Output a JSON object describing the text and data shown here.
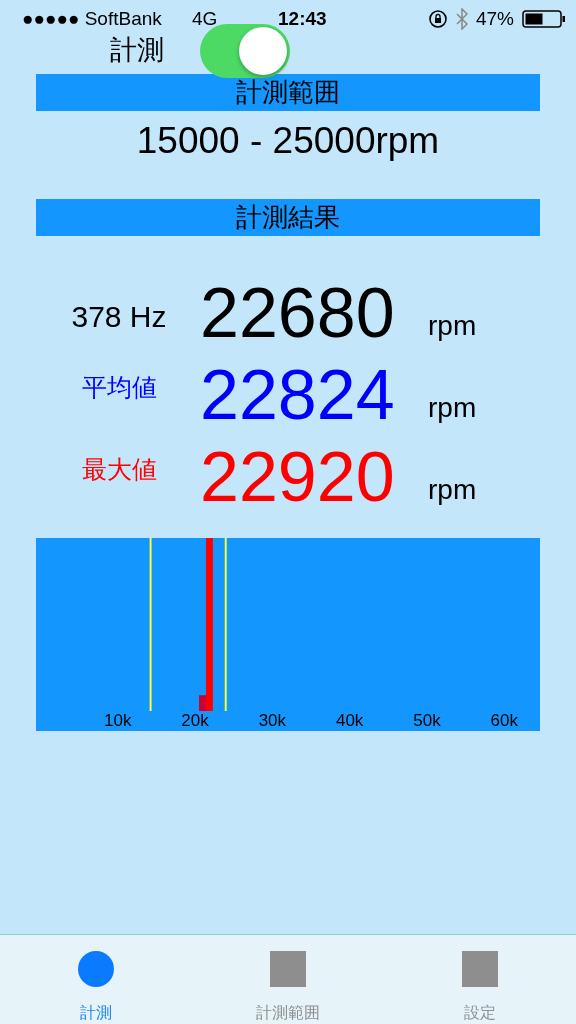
{
  "status_bar": {
    "carrier": "●●●●● SoftBank",
    "network": "4G",
    "time": "12:43",
    "battery": "47%"
  },
  "header": {
    "title": "計測",
    "toggle": {
      "on": true
    }
  },
  "range_section": {
    "heading": "計測範囲",
    "value": "15000 - 25000rpm"
  },
  "result_section": {
    "heading": "計測結果",
    "rows": [
      {
        "kind": "current",
        "label": "378  Hz",
        "value": "22680",
        "unit": "rpm",
        "color": "#000000"
      },
      {
        "kind": "average",
        "label": "平均値",
        "value": "22824",
        "unit": "rpm",
        "color": "#0000ff"
      },
      {
        "kind": "max",
        "label": "最大値",
        "value": "22920",
        "unit": "rpm",
        "color": "#ff0000"
      }
    ]
  },
  "spectrum": {
    "axis_labels": [
      "10k",
      "20k",
      "30k",
      "40k",
      "50k",
      "60k"
    ]
  },
  "tab_bar": [
    {
      "label": "計測",
      "selected": true
    },
    {
      "label": "計測範囲",
      "selected": false
    },
    {
      "label": "設定",
      "selected": false
    }
  ]
}
